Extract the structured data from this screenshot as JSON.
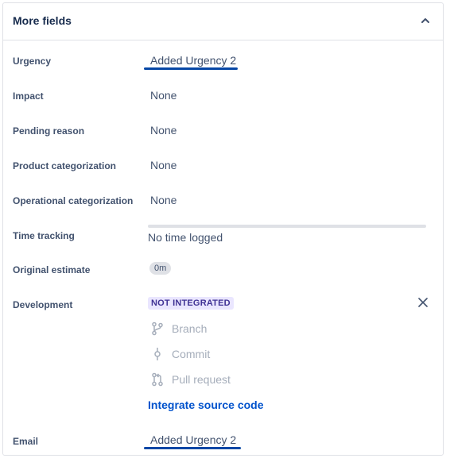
{
  "panel": {
    "title": "More fields"
  },
  "fields": {
    "urgency": {
      "label": "Urgency",
      "value": "Added Urgency 2"
    },
    "impact": {
      "label": "Impact",
      "value": "None"
    },
    "pending_reason": {
      "label": "Pending reason",
      "value": "None"
    },
    "product_categorization": {
      "label": "Product categorization",
      "value": "None"
    },
    "operational_categorization": {
      "label": "Operational categorization",
      "value": "None"
    },
    "time_tracking": {
      "label": "Time tracking",
      "value": "No time logged",
      "progress": 0
    },
    "original_estimate": {
      "label": "Original estimate",
      "value": "0m"
    },
    "development": {
      "label": "Development",
      "status": "NOT INTEGRATED",
      "items": [
        "Branch",
        "Commit",
        "Pull request"
      ],
      "link": "Integrate source code"
    },
    "email": {
      "label": "Email",
      "value": "Added Urgency 2"
    }
  },
  "colors": {
    "annotation_underline": "#0747a6",
    "link": "#0052cc",
    "lozenge_bg": "#eae6ff",
    "lozenge_text": "#403294"
  },
  "icons": {
    "collapse": "chevron-up-icon",
    "close": "close-icon",
    "branch": "branch-icon",
    "commit": "commit-icon",
    "pull_request": "pull-request-icon"
  }
}
